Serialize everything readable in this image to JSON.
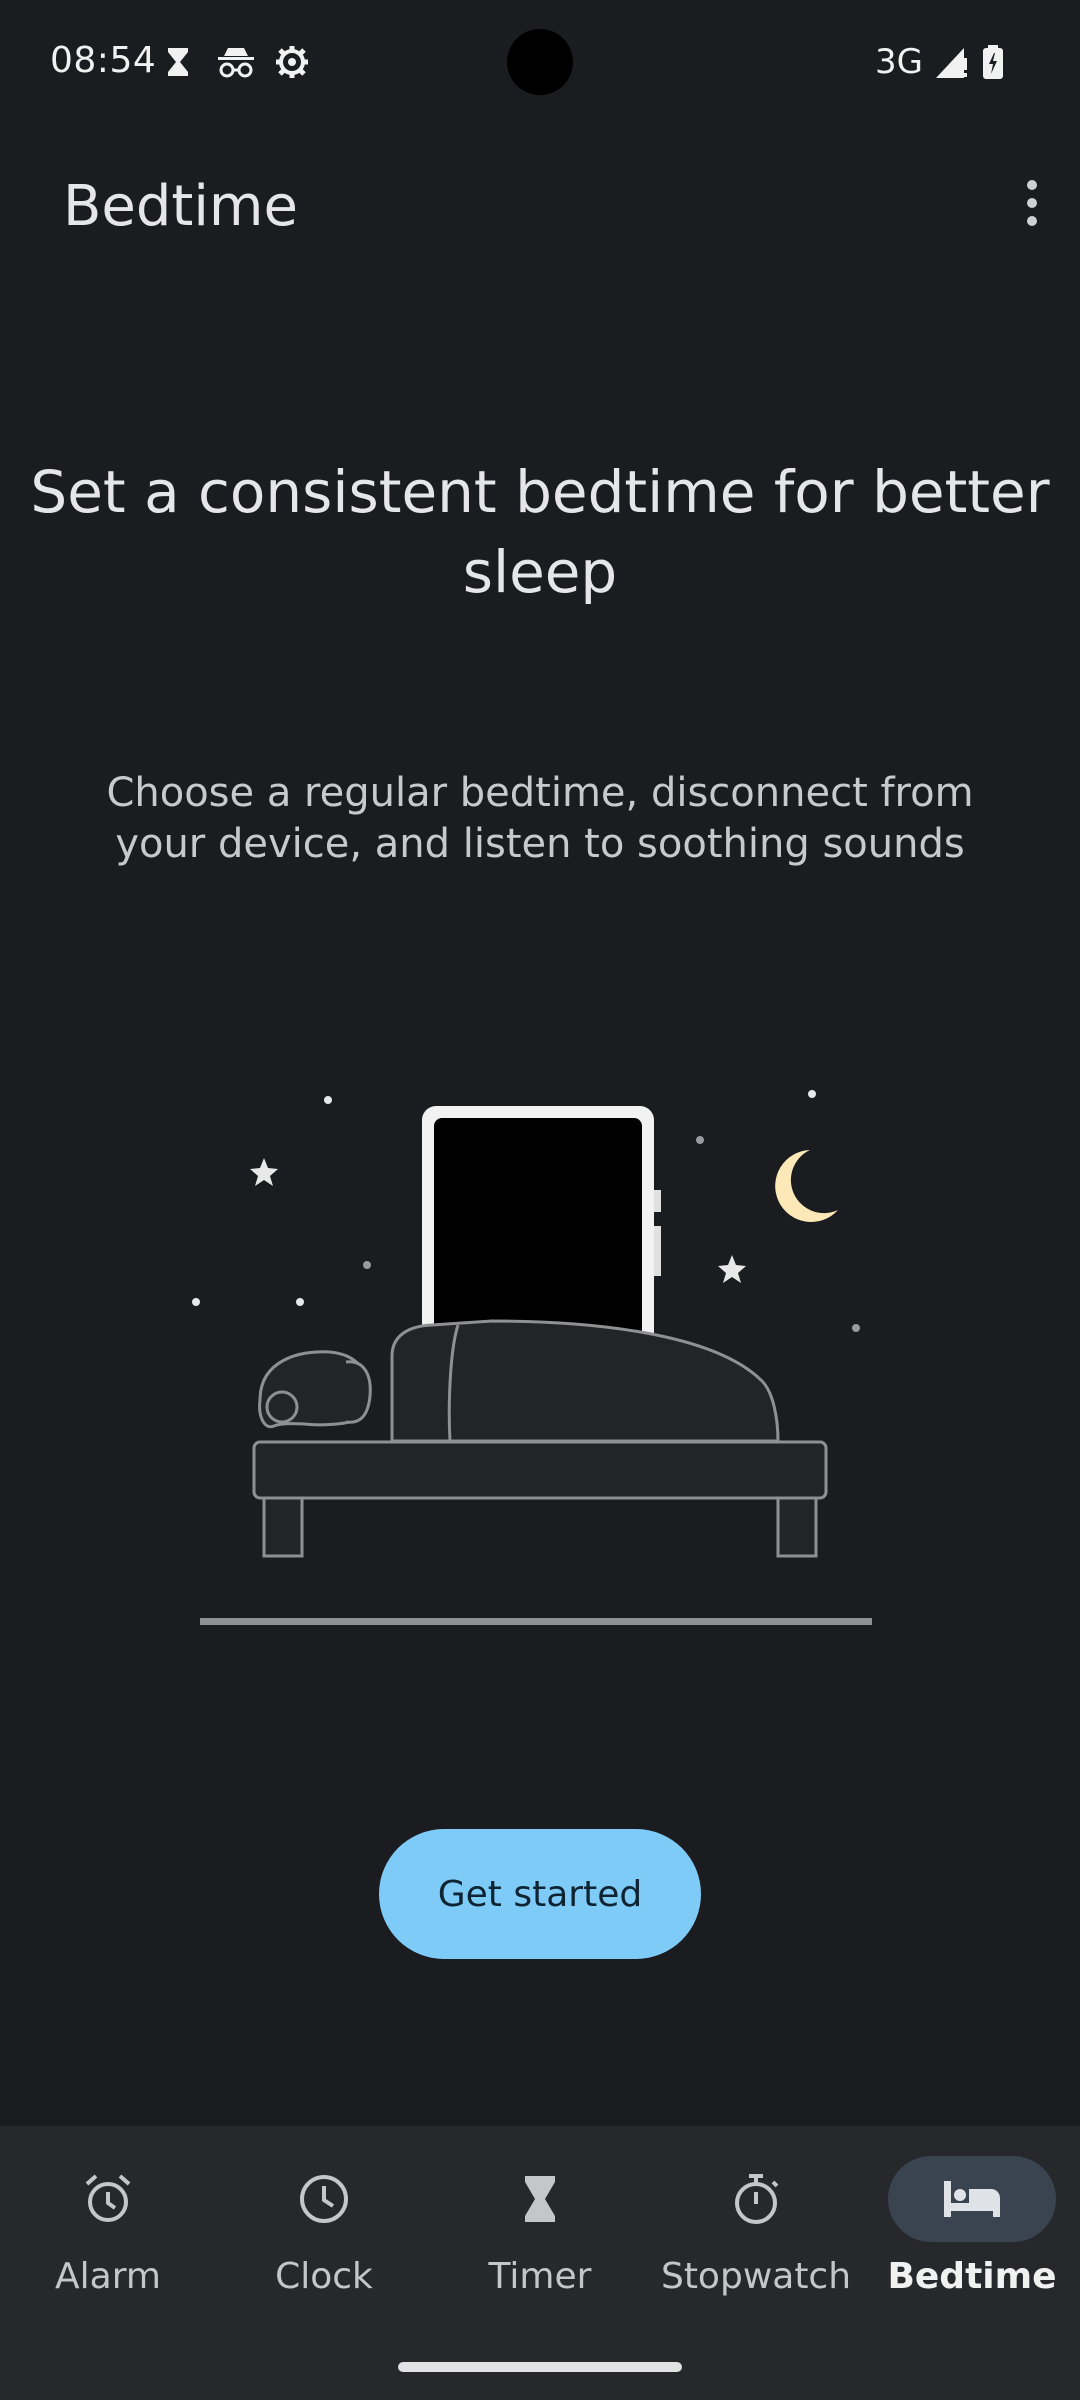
{
  "status_bar": {
    "time": "08:54",
    "network": "3G",
    "icons": [
      "hourglass-icon",
      "incognito-icon",
      "settings-gear-icon",
      "signal-icon",
      "battery-charging-icon"
    ]
  },
  "app_bar": {
    "title": "Bedtime",
    "overflow_icon": "more-vert-icon"
  },
  "content": {
    "headline": "Set a consistent bedtime for better sleep",
    "subtext": "Choose a regular bedtime, disconnect from your device, and listen to soothing sounds",
    "cta_label": "Get started"
  },
  "bottom_nav": {
    "items": [
      {
        "label": "Alarm",
        "icon": "alarm-icon",
        "active": false
      },
      {
        "label": "Clock",
        "icon": "clock-icon",
        "active": false
      },
      {
        "label": "Timer",
        "icon": "hourglass-icon",
        "active": false
      },
      {
        "label": "Stopwatch",
        "icon": "stopwatch-icon",
        "active": false
      },
      {
        "label": "Bedtime",
        "icon": "bed-icon",
        "active": true
      }
    ]
  },
  "colors": {
    "background": "#1b1c1f",
    "nav_background": "#26282c",
    "accent": "#7ecbf7",
    "active_pill": "#3a4450",
    "moon": "#fde9b8"
  }
}
